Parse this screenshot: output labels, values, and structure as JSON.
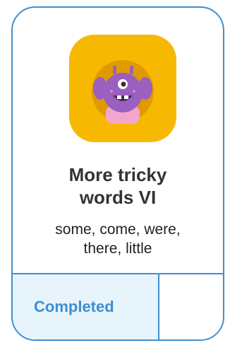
{
  "lesson": {
    "icon": "purple-monster-icon",
    "title_line1": "More tricky",
    "title_line2": "words VI",
    "subtitle_line1": "some, come, were,",
    "subtitle_line2": "there, little",
    "status": "Completed"
  },
  "colors": {
    "border": "#3d8fd1",
    "tile": "#f6b800",
    "status_text": "#3d8fd1",
    "status_bg": "#e8f4fc"
  }
}
